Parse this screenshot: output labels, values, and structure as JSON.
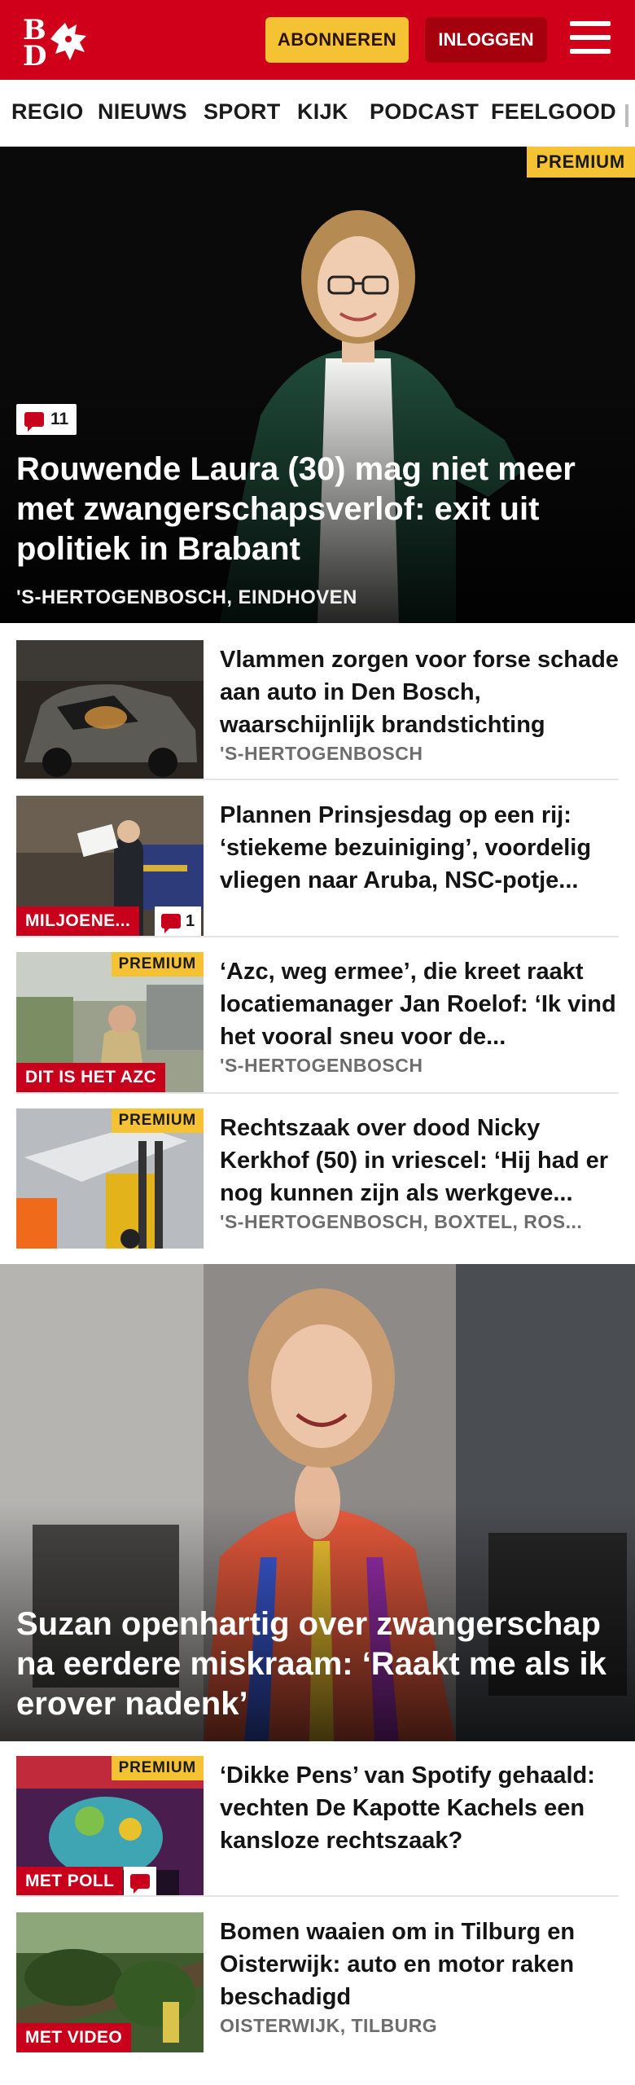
{
  "header": {
    "logo_letters": "BD",
    "subscribe_label": "ABONNEREN",
    "login_label": "INLOGGEN",
    "brand_color": "#d0001b"
  },
  "nav": {
    "items": [
      "REGIO",
      "NIEUWS",
      "SPORT",
      "KIJK",
      "PODCAST",
      "FEELGOOD"
    ]
  },
  "hero1": {
    "badge": "PREMIUM",
    "comments": "11",
    "title": "Rouwende Laura (30) mag niet meer met zwangerschapsverlof: exit uit politiek in Brabant",
    "location": "'S-HERTOGENBOSCH, EINDHOVEN"
  },
  "articles": [
    {
      "title": "Vlammen zorgen voor forse schade aan auto in Den Bosch, waarschijnlijk brandstichting",
      "location": "'S-HERTOGENBOSCH"
    },
    {
      "title": "Plannen Prinsjesdag op een rij: ‘stiekeme bezuiniging’, voordelig vliegen naar Aruba, NSC-potje...",
      "label": "MILJOENE...",
      "comments": "1"
    },
    {
      "badge": "PREMIUM",
      "title": "‘Azc, weg ermee’, die kreet raakt locatiemanager Jan Roelof: ‘Ik vind het vooral sneu voor de...",
      "label": "DIT IS HET AZC",
      "location": "'S-HERTOGENBOSCH"
    },
    {
      "badge": "PREMIUM",
      "title": "Rechtszaak over dood Nicky Kerkhof (50) in vriescel: ‘Hij had er nog kunnen zijn als werkgeve...",
      "location": "'S-HERTOGENBOSCH, BOXTEL, ROS..."
    }
  ],
  "hero2": {
    "title": "Suzan openhartig over zwangerschap na eerdere miskraam: ‘Raakt me als ik erover nadenk’"
  },
  "articles2": [
    {
      "badge": "PREMIUM",
      "title": "‘Dikke Pens’ van Spotify gehaald: vechten De Kapotte Kachels een kansloze rechtszaak?",
      "label": "MET POLL"
    },
    {
      "title": "Bomen waaien om in Tilburg en Oisterwijk: auto en motor raken beschadigd",
      "label": "MET VIDEO",
      "location": "OISTERWIJK, TILBURG"
    }
  ]
}
